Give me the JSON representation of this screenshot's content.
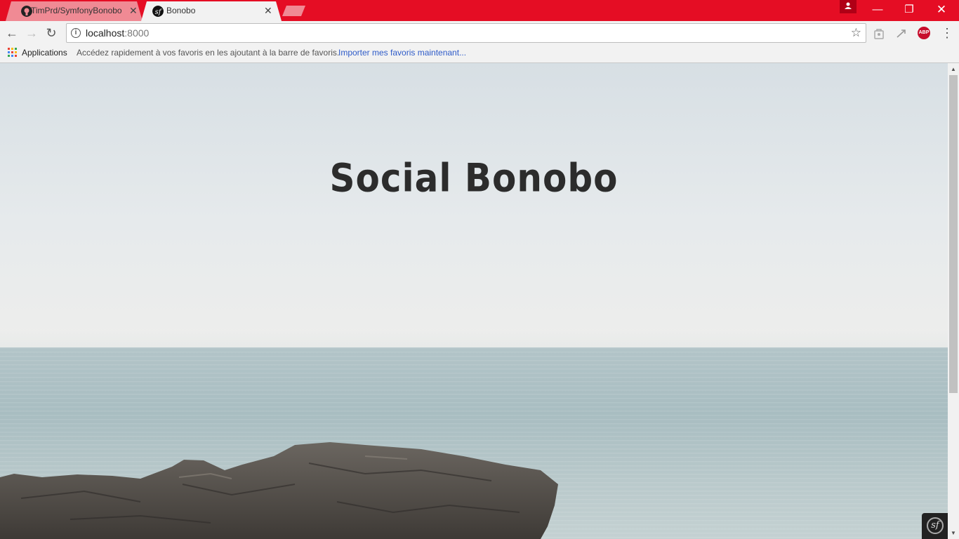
{
  "browser": {
    "tabs": [
      {
        "title": "TimPrd/SymfonyBonobo",
        "favicon": "github-icon",
        "active": false
      },
      {
        "title": "Bonobo",
        "favicon": "symfony-icon",
        "active": true
      }
    ],
    "tab_close_glyph": "✕",
    "window_controls": {
      "minimize": "—",
      "restore": "❐",
      "close": "✕"
    },
    "toolbar": {
      "back": "←",
      "forward": "→",
      "reload": "↻",
      "address_host": "localhost",
      "address_port": ":8000",
      "info_glyph": "i",
      "bookmark_star": "☆",
      "adblock_label": "ABP",
      "menu_glyph": "⋮"
    },
    "bookmarks": {
      "apps_label": "Applications",
      "hint": "Accédez rapidement à vos favoris en les ajoutant à la barre de favoris.",
      "import_link": "Importer mes favoris maintenant..."
    }
  },
  "page": {
    "heading": "Social Bonobo"
  },
  "colors": {
    "chrome_red": "#e50d24",
    "toolbar_bg": "#f2f2f2",
    "link_blue": "#2e5bc8",
    "heading": "#2c2c2c"
  }
}
